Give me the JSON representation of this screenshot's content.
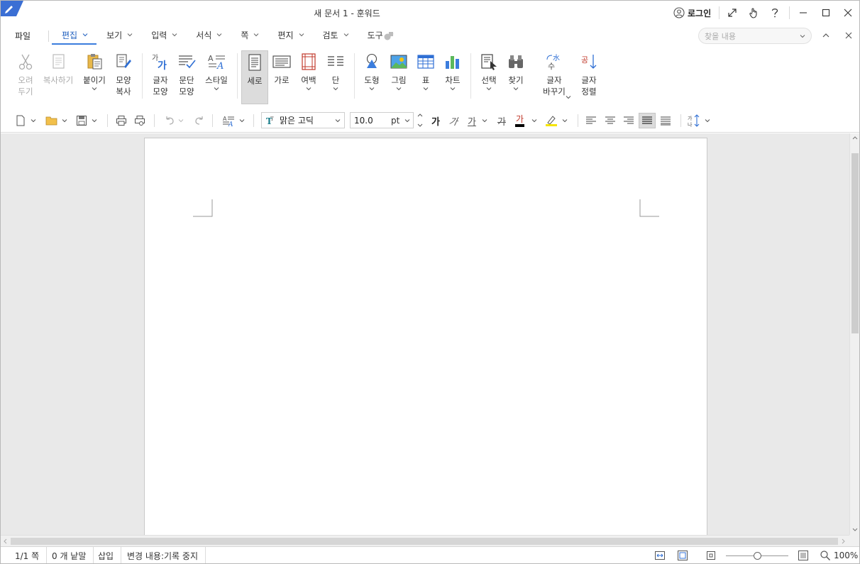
{
  "window": {
    "title": "새 문서 1 - 훈워드",
    "login_label": "로그인"
  },
  "menu": {
    "file": "파일",
    "tabs": [
      "편집",
      "보기",
      "입력",
      "서식",
      "쪽",
      "편지",
      "검토",
      "도구"
    ],
    "active_tab": "편집",
    "search_placeholder": "찾을 내용"
  },
  "ribbon": {
    "cut": "오려\n두기",
    "copy": "복사하기",
    "paste": "붙이기",
    "format_copy": "모양\n복사",
    "char_shape": "글자\n모양",
    "para_shape": "문단\n모양",
    "style": "스타일",
    "portrait": "세로",
    "landscape": "가로",
    "margin": "여백",
    "column": "단",
    "shape": "도형",
    "picture": "그림",
    "table": "표",
    "chart": "차트",
    "select": "선택",
    "find": "찾기",
    "replace": "글자\n바꾸기",
    "sort": "글자\n정렬"
  },
  "toolbar": {
    "font_name": "맑은 고딕",
    "font_size": "10.0",
    "font_unit": "pt",
    "bold_glyph": "가",
    "italic_glyph": "가",
    "underline_glyph": "가",
    "strike_glyph": "가",
    "color_glyph": "가"
  },
  "status": {
    "page": "1/1 쪽",
    "words": "0 개 낱말",
    "mode": "삽입",
    "track": "변경 내용:기록 중지",
    "zoom": "100%"
  },
  "colors": {
    "accent": "#3b7ddd",
    "brand": "#2f6fd4"
  }
}
